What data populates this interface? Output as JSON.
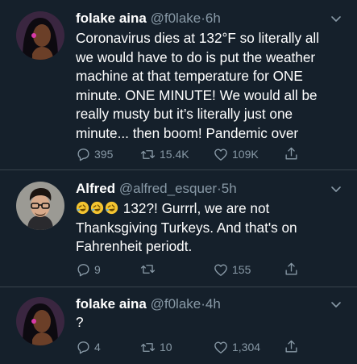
{
  "tweets": [
    {
      "name": "folake aina",
      "handle": "@f0lake",
      "dot": "·",
      "time": "6h",
      "text": "Coronavirus dies at 132°F so literally all we would have to do is put the weather machine at that temperature for ONE minute. ONE MINUTE! We would all be really musty but it’s literally just one minute... then boom! Pandemic over",
      "replies": "395",
      "retweets": "15.4K",
      "likes": "109K"
    },
    {
      "name": "Alfred",
      "handle": "@alfred_esquer",
      "dot": "·",
      "time": "5h",
      "emojis": [
        "rofl-emoji",
        "rofl-emoji",
        "rofl-emoji"
      ],
      "text": "132?! Gurrrl, we are not Thanksgiving Turkeys. And that's on Fahrenheit periodt.",
      "replies": "9",
      "retweets": "",
      "likes": "155"
    },
    {
      "name": "folake aina",
      "handle": "@f0lake",
      "dot": "·",
      "time": "4h",
      "text": "?",
      "replies": "4",
      "retweets": "10",
      "likes": "1,304"
    }
  ],
  "colors": {
    "background": "#15202b",
    "muted": "#8899a6",
    "divider": "#38444d",
    "text": "#ffffff"
  },
  "icons": [
    "reply-icon",
    "retweet-icon",
    "like-icon",
    "share-icon",
    "chevron-down-icon"
  ]
}
